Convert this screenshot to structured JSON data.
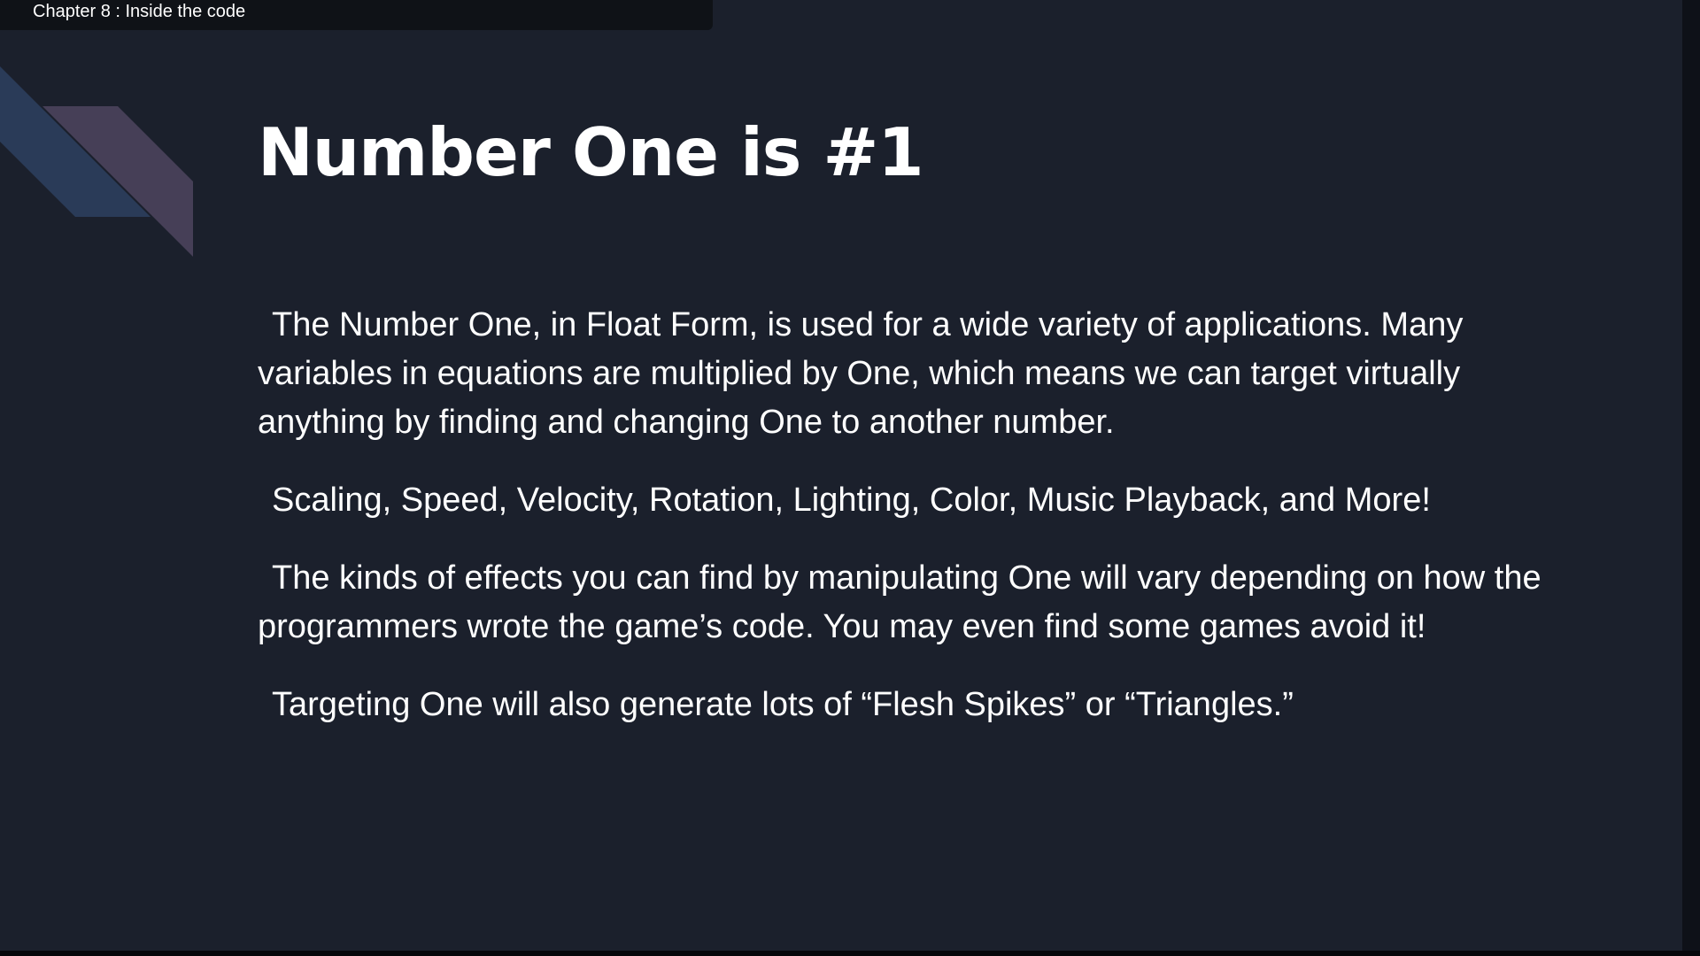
{
  "header": {
    "chapter_title": "Chapter 8 : Inside the code"
  },
  "slide": {
    "title": "Number One is #1",
    "paragraphs": [
      "The Number One, in Float Form, is used for a wide variety of applications.  Many variables in equations are multiplied by One, which means we can target virtually anything by finding and changing One to another number.",
      "Scaling, Speed, Velocity, Rotation, Lighting, Color, Music Playback, and More!",
      "The kinds of effects you can find by manipulating One will vary depending on how the programmers wrote the game’s code.  You may even find some games avoid it!",
      "Targeting One will also generate lots of “Flesh Spikes” or “Triangles.”"
    ]
  },
  "colors": {
    "slide_background": "#1b202c",
    "accent_blue": "#2a3b58",
    "accent_purple": "#463f57",
    "text": "#ffffff"
  }
}
